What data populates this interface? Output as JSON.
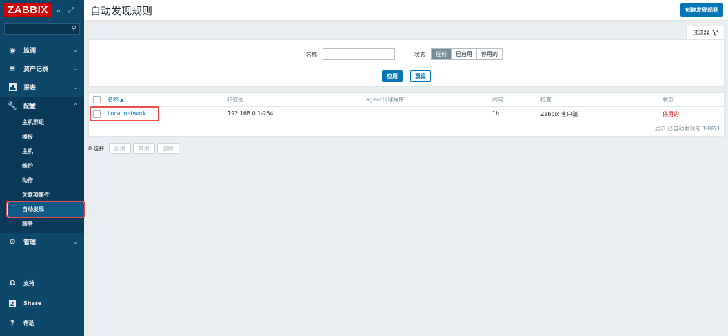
{
  "sidebar": {
    "logo": "ZABBIX",
    "collapse_icon": "«",
    "popout_icon": "⤢",
    "search_placeholder": "",
    "menu": [
      {
        "label": "监测",
        "icon": "eye-icon"
      },
      {
        "label": "资产记录",
        "icon": "list-icon"
      },
      {
        "label": "报表",
        "icon": "bar-chart-icon"
      },
      {
        "label": "配置",
        "icon": "wrench-icon"
      },
      {
        "label": "管理",
        "icon": "gear-icon"
      }
    ],
    "submenu": [
      {
        "label": "主机群组"
      },
      {
        "label": "模板"
      },
      {
        "label": "主机"
      },
      {
        "label": "维护"
      },
      {
        "label": "动作"
      },
      {
        "label": "关联项事件"
      },
      {
        "label": "自动发现"
      },
      {
        "label": "服务"
      }
    ],
    "bottom": [
      {
        "label": "支持",
        "icon": "headset-icon"
      },
      {
        "label": "Share",
        "icon": "share-icon"
      },
      {
        "label": "帮助",
        "icon": "help-icon"
      }
    ]
  },
  "header": {
    "title": "自动发现规则",
    "create_button": "创建发现规则"
  },
  "filter": {
    "tab_label": "过滤器",
    "name_label": "名称",
    "name_value": "",
    "status_label": "状态",
    "status_options": [
      "任何",
      "已启用",
      "停用的"
    ],
    "status_selected": "任何",
    "apply_label": "应用",
    "reset_label": "重设"
  },
  "table": {
    "headers": {
      "name": "名称",
      "sort_arrow": "▲",
      "ip_range": "IP范围",
      "proxy": "agent代理程序",
      "interval": "间隔",
      "checks": "检查",
      "status": "状态"
    },
    "rows": [
      {
        "name": "Local network",
        "ip_range": "192.168.0.1-254",
        "proxy": "",
        "interval": "1h",
        "checks": "Zabbix 客户端",
        "status": "停用的"
      }
    ],
    "footer": "显示 已自动发现的 1中的1"
  },
  "actions": {
    "count": "0 选择",
    "enable": "启用",
    "disable": "禁用",
    "delete": "删除"
  },
  "colors": {
    "sidebar_bg": "#0d4769",
    "logo_bg": "#d40000",
    "primary": "#0275b8",
    "disabled_status": "#d40000",
    "highlight_box": "#e84d4d"
  }
}
